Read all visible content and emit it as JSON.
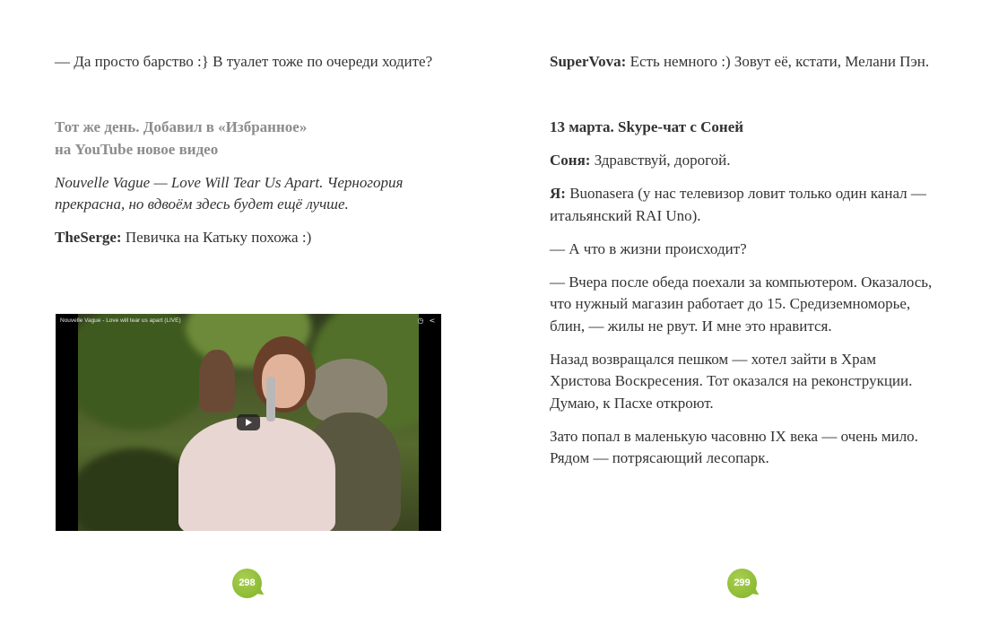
{
  "left_page": {
    "para1": "— Да просто барство :} В туалет тоже по очереди ходите?",
    "heading_line1": "Тот же день. Добавил в «Избранное»",
    "heading_line2": "на YouTube новое видео",
    "quote": "Nouvelle Vague — Love Will Tear Us Apart. Черногория прекрасна, но вдвоём здесь будет ещё лучше.",
    "reply_speaker": "TheSerge:",
    "reply_text": " Певичка на Катьку похожа :)",
    "video": {
      "title": "Nouvelle Vague - Love will tear us apart (LIVE)",
      "icons": [
        "clock-icon",
        "share-icon"
      ],
      "play_icon": "play-icon"
    },
    "page_number": "298"
  },
  "right_page": {
    "para1_speaker": "SuperVova:",
    "para1_text": " Есть немного :) Зовут её, кстати, Мелани Пэн.",
    "heading": "13 марта. Skype-чат с Соней",
    "line_sonya_speaker": "Соня:",
    "line_sonya_text": " Здравствуй, дорогой.",
    "line_me_speaker": "Я:",
    "line_me_text": " Buonasera (у нас телевизор ловит только один канал — итальянский RAI Uno).",
    "line_q": "— А что в жизни происходит?",
    "line_a": "— Вчера после обеда поехали за компьютером. Оказалось, что нужный магазин работает до 15. Средиземноморье, блин, — жилы не рвут. И мне это нравится.",
    "line_b": "Назад возвращался пешком — хотел зайти в Храм Христова Воскресения. Тот оказался на реконструкции. Думаю, к Пасхе откроют.",
    "line_c": "Зато попал в маленькую часовню IX века — очень мило. Рядом — потрясающий лесопарк.",
    "page_number": "299"
  },
  "colors": {
    "text": "#333333",
    "heading_gray": "#8c8c8c",
    "badge_green": "#8dbb33"
  }
}
